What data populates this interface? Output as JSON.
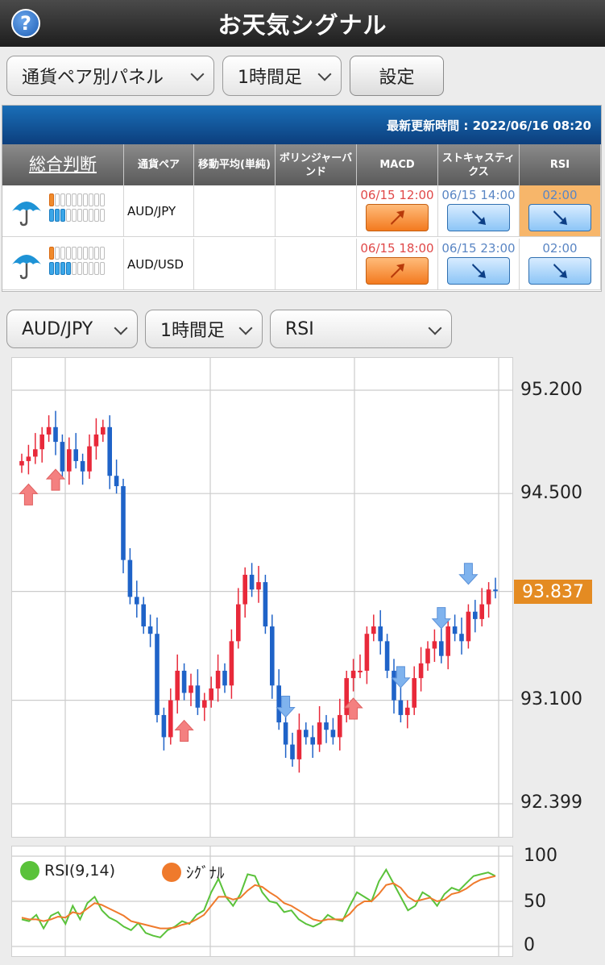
{
  "header": {
    "title": "お天気シグナル",
    "help_label": "?"
  },
  "controls": {
    "panel_select": "通貨ペア別パネル",
    "timeframe_select": "1時間足",
    "settings_button": "設定"
  },
  "table": {
    "updated": "最新更新時間 : 2022/06/16 08:20",
    "headers": {
      "overall": "総合判断",
      "pair": "通貨ペア",
      "ma": "移動平均(単純)",
      "bollinger": "ボリンジャーバンド",
      "macd": "MACD",
      "stoch": "ストキャスティクス",
      "rsi": "RSI"
    },
    "rows": [
      {
        "pair": "AUD/JPY",
        "weather_icon": "umbrella-icon",
        "orange_level": 1,
        "blue_level": 3,
        "macd_time": "06/15 12:00",
        "macd_dir": "up",
        "stoch_time": "06/15 14:00",
        "stoch_dir": "down",
        "rsi_time": "02:00",
        "rsi_dir": "down",
        "rsi_highlight": true
      },
      {
        "pair": "AUD/USD",
        "weather_icon": "umbrella-icon",
        "orange_level": 1,
        "blue_level": 4,
        "macd_time": "06/15 18:00",
        "macd_dir": "up",
        "stoch_time": "06/15 23:00",
        "stoch_dir": "down",
        "rsi_time": "02:00",
        "rsi_dir": "down",
        "rsi_highlight": false
      }
    ]
  },
  "chart_controls": {
    "pair_select": "AUD/JPY",
    "timeframe_select": "1時間足",
    "indicator_select": "RSI"
  },
  "colors": {
    "up": "#e8293a",
    "down": "#1f63c8",
    "signal_up": "#f48080",
    "signal_down": "#7fb3ee",
    "rsi": "#5ac23a",
    "signal": "#ef7a2c",
    "price_tag": "#e48b22"
  },
  "chart_data": [
    {
      "type": "candlestick",
      "y_ticks": [
        "95.200",
        "94.500",
        "93.100",
        "92.399"
      ],
      "ylim": [
        92.399,
        95.2
      ],
      "current_price": "93.837",
      "closes": [
        94.72,
        94.75,
        94.8,
        94.9,
        94.95,
        94.85,
        94.65,
        94.8,
        94.72,
        94.65,
        94.82,
        94.9,
        94.95,
        94.62,
        94.55,
        94.05,
        93.8,
        93.75,
        93.6,
        93.55,
        93.0,
        92.85,
        93.1,
        93.3,
        93.15,
        93.2,
        93.05,
        93.1,
        93.18,
        93.3,
        93.2,
        93.5,
        93.75,
        93.95,
        93.85,
        93.9,
        93.6,
        93.2,
        92.95,
        92.8,
        92.7,
        92.9,
        92.85,
        92.8,
        92.95,
        92.9,
        92.85,
        93.0,
        93.25,
        93.3,
        93.3,
        93.55,
        93.6,
        93.5,
        93.3,
        93.1,
        93.0,
        93.05,
        93.25,
        93.35,
        93.45,
        93.5,
        93.4,
        93.6,
        93.55,
        93.5,
        93.7,
        93.65,
        93.75,
        93.85,
        93.84
      ],
      "buy_signals": [
        1,
        5,
        24,
        49
      ],
      "sell_signals": [
        39,
        56,
        62,
        66,
        71
      ]
    },
    {
      "type": "line",
      "y_ticks": [
        "100",
        "50",
        "0"
      ],
      "ylim": [
        0,
        100
      ],
      "legend": [
        "RSI(9,14)",
        "ｼｸﾞﾅﾙ"
      ],
      "series": [
        {
          "name": "RSI(9,14)",
          "values": [
            30,
            28,
            35,
            20,
            34,
            38,
            25,
            45,
            30,
            48,
            55,
            40,
            32,
            28,
            22,
            18,
            26,
            15,
            12,
            10,
            18,
            22,
            28,
            25,
            35,
            40,
            60,
            75,
            55,
            45,
            58,
            80,
            78,
            60,
            50,
            48,
            38,
            40,
            30,
            25,
            22,
            26,
            35,
            30,
            28,
            45,
            60,
            55,
            50,
            72,
            85,
            70,
            55,
            40,
            45,
            60,
            55,
            45,
            58,
            65,
            62,
            70,
            78,
            80,
            82,
            78
          ]
        },
        {
          "name": "ｼｸﾞﾅﾙ",
          "values": [
            32,
            30,
            30,
            28,
            30,
            33,
            32,
            38,
            36,
            42,
            48,
            46,
            42,
            38,
            34,
            28,
            26,
            24,
            22,
            20,
            20,
            21,
            24,
            26,
            30,
            35,
            45,
            55,
            55,
            52,
            54,
            62,
            68,
            66,
            60,
            55,
            48,
            45,
            40,
            35,
            30,
            28,
            30,
            30,
            30,
            36,
            45,
            50,
            50,
            58,
            68,
            70,
            65,
            55,
            50,
            52,
            54,
            50,
            52,
            58,
            60,
            64,
            70,
            74,
            76,
            78
          ]
        }
      ]
    }
  ]
}
